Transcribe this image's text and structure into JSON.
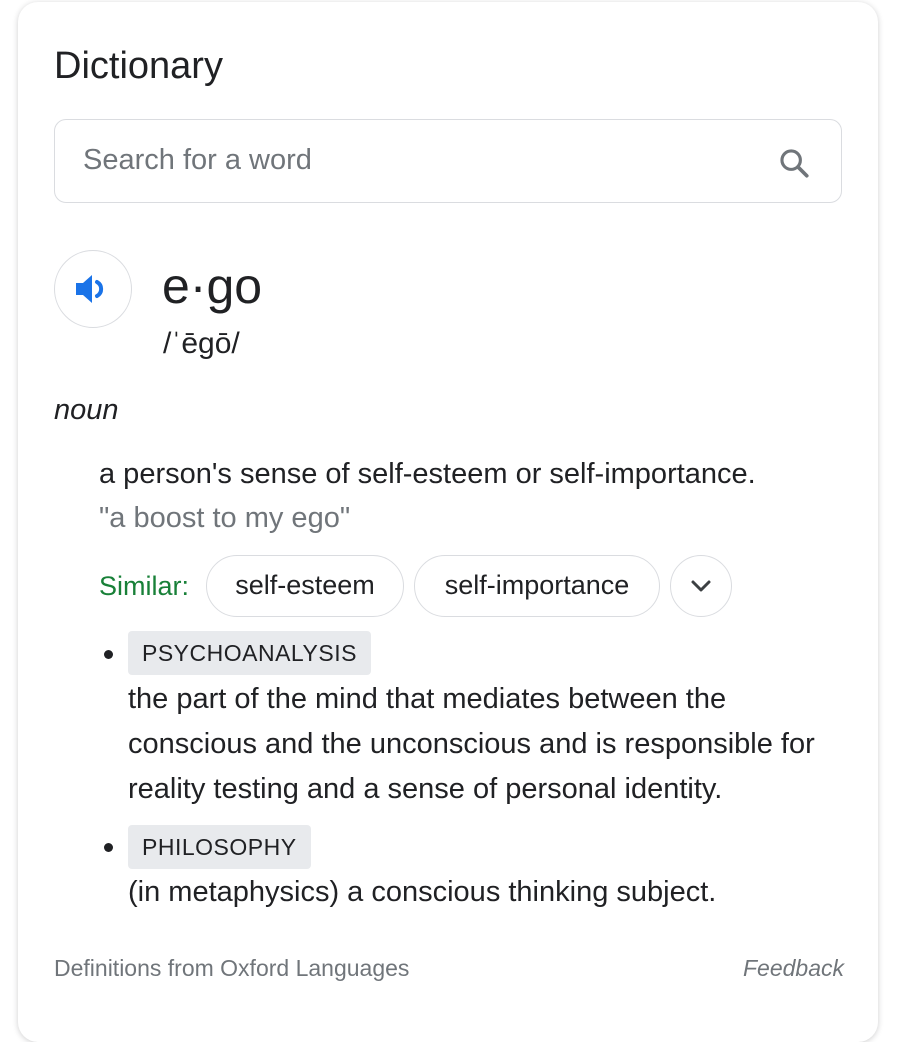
{
  "card": {
    "title": "Dictionary",
    "search": {
      "placeholder": "Search for a word",
      "value": "",
      "icon": "search-icon"
    },
    "entry": {
      "speaker_icon": "volume-icon",
      "headword": "e·go",
      "phonetic": "/ˈēgō/",
      "part_of_speech": "noun",
      "senses": [
        {
          "definition": "a person's sense of self-esteem or self-importance.",
          "example": "\"a boost to my ego\"",
          "similar_label": "Similar:",
          "similar": [
            "self-esteem",
            "self-importance"
          ],
          "more_icon": "chevron-down-icon"
        },
        {
          "label": "PSYCHOANALYSIS",
          "definition": "the part of the mind that mediates between the conscious and the unconscious and is responsible for reality testing and a sense of personal identity."
        },
        {
          "label": "PHILOSOPHY",
          "definition": "(in metaphysics) a conscious thinking subject."
        }
      ]
    },
    "footer": {
      "source": "Definitions from Oxford Languages",
      "feedback": "Feedback"
    }
  },
  "colors": {
    "accent_blue": "#1a73e8",
    "similar_green": "#188038",
    "secondary_text": "#70757a",
    "border": "#dadce0",
    "tag_background": "#e8eaed"
  }
}
